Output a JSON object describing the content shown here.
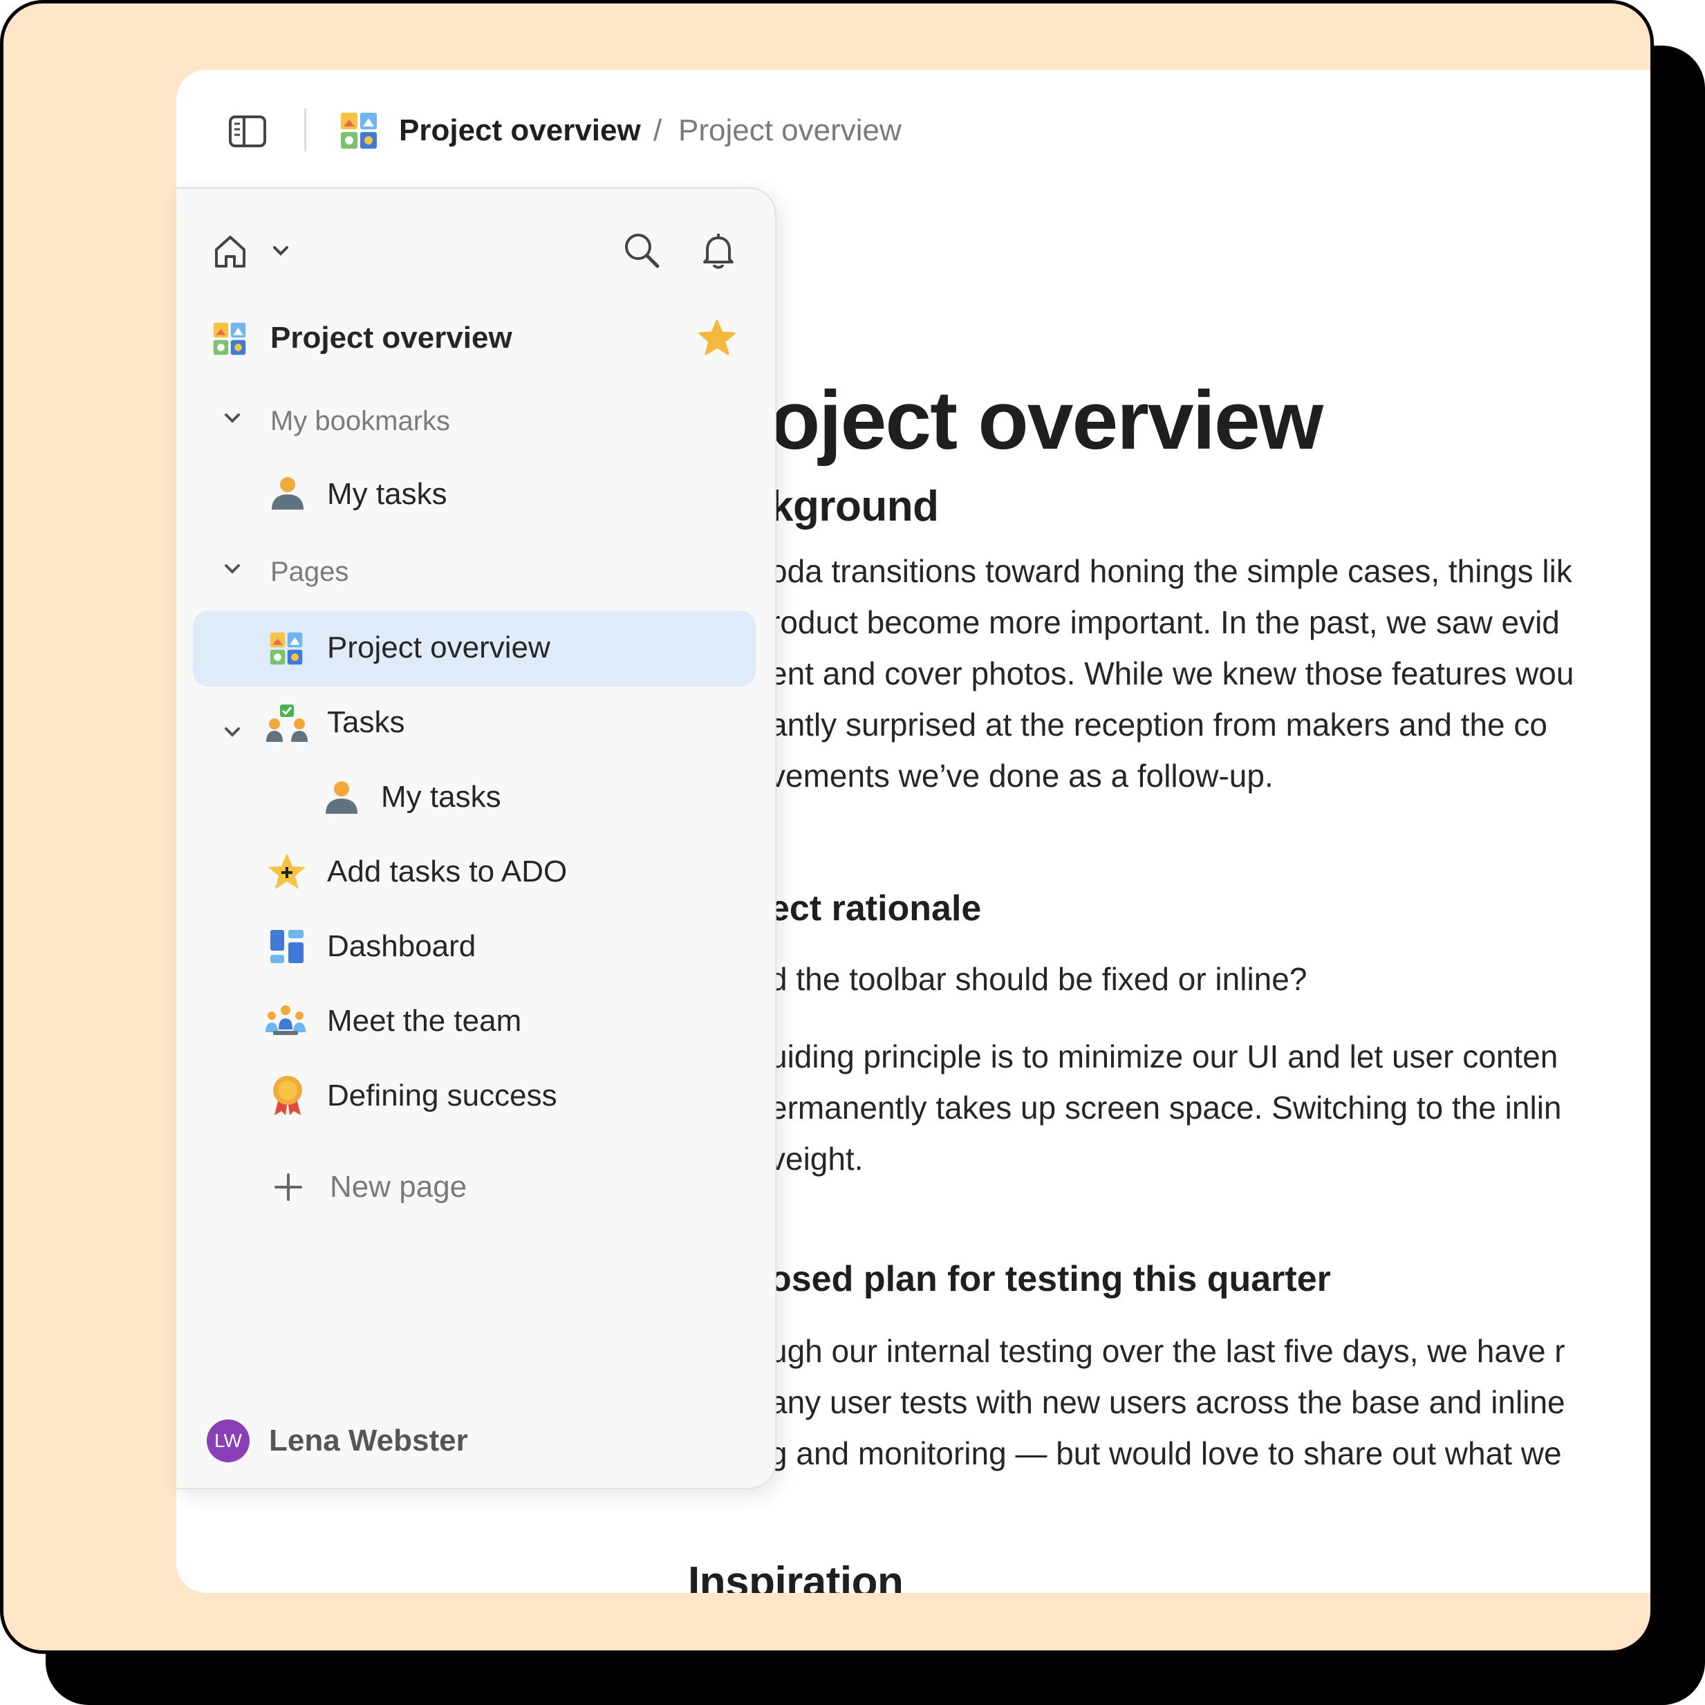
{
  "breadcrumb": {
    "current": "Project overview",
    "separator": "/",
    "page": "Project overview"
  },
  "document": {
    "title": "oject overview",
    "sections": [
      {
        "heading": "kground",
        "paragraphs": [
          "oda transitions toward honing the simple cases, things lik",
          "roduct become more important. In the past, we saw evid",
          "ent and cover photos. While we knew those features wou",
          "antly surprised at the reception from makers and the co",
          "vements we’ve done as a follow-up."
        ]
      },
      {
        "heading": "ect rationale",
        "paragraphs": [
          "d the toolbar should be fixed or inline?",
          "uiding principle is to minimize our UI and let user conten",
          "ermanently takes up screen space. Switching to the inlin",
          "veight."
        ]
      },
      {
        "heading": "osed plan for testing this quarter",
        "paragraphs": [
          "ugh our internal testing over the last five days, we have r",
          "any user tests with new users across the base and inline",
          "g and monitoring — but would love to share out what we"
        ]
      },
      {
        "heading": "Inspiration"
      }
    ]
  },
  "sidebar": {
    "header": {
      "home_icon": "home-icon",
      "chevron_icon": "chevron-down-icon",
      "search_icon": "search-icon",
      "bell_icon": "bell-icon"
    },
    "doc_title": "Project overview",
    "favorite_icon": "star-icon",
    "sections": {
      "bookmarks": "My bookmarks",
      "pages": "Pages"
    },
    "bookmarks": [
      {
        "label": "My tasks",
        "icon": "person-icon"
      }
    ],
    "pages": [
      {
        "label": "Project overview",
        "icon": "project-grid-icon",
        "selected": true
      },
      {
        "label": "Tasks",
        "icon": "team-tasks-icon"
      },
      {
        "label": "My tasks",
        "icon": "person-icon"
      },
      {
        "label": "Add tasks to ADO",
        "icon": "sparkle-star-icon"
      },
      {
        "label": "Dashboard",
        "icon": "dashboard-icon"
      },
      {
        "label": "Meet the team",
        "icon": "team-icon"
      },
      {
        "label": "Defining success",
        "icon": "medal-icon"
      }
    ],
    "new_page": "New page",
    "user": {
      "initials": "LW",
      "name": "Lena Webster"
    }
  },
  "colors": {
    "frame_background": "#ffe6c9",
    "selected_row": "#dfebf8",
    "star": "#f4b83e",
    "avatar": "#8b3fb7"
  }
}
